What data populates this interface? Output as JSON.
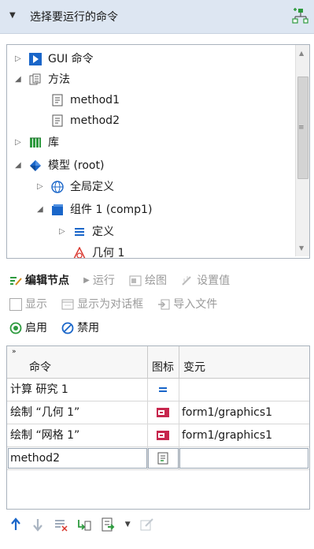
{
  "header": {
    "title": "选择要运行的命令",
    "tool_icon": "tree-add-icon"
  },
  "tree": {
    "items": [
      {
        "label": "GUI 命令",
        "icon": "gui-command-icon",
        "expander": "collapsed"
      },
      {
        "label": "方法",
        "icon": "methods-folder-icon",
        "expander": "expanded"
      },
      {
        "label": "method1",
        "icon": "method-icon",
        "expander": "none"
      },
      {
        "label": "method2",
        "icon": "method-icon",
        "expander": "none"
      },
      {
        "label": "库",
        "icon": "library-icon",
        "expander": "collapsed"
      },
      {
        "label": "模型 (root)",
        "icon": "model-icon",
        "expander": "expanded"
      },
      {
        "label": "全局定义",
        "icon": "globe-icon",
        "expander": "collapsed"
      },
      {
        "label": "组件 1 (comp1)",
        "icon": "component-icon",
        "expander": "expanded"
      },
      {
        "label": "定义",
        "icon": "definitions-icon",
        "expander": "collapsed"
      },
      {
        "label": "几何 1",
        "icon": "geometry-icon",
        "expander": "none"
      }
    ]
  },
  "toolbar": {
    "edit_node": "编辑节点",
    "run": "运行",
    "plot": "绘图",
    "set_value": "设置值",
    "show": "显示",
    "show_as_dialog": "显示为对话框",
    "import_file": "导入文件",
    "enable": "启用",
    "disable": "禁用"
  },
  "grid": {
    "headers": {
      "command": "命令",
      "icon": "图标",
      "argument": "变元"
    },
    "rows": [
      {
        "command": "计算 研究 1",
        "icon": "compute-icon",
        "argument": ""
      },
      {
        "command": "绘制 “几何 1”",
        "icon": "plot-icon",
        "argument": "form1/graphics1"
      },
      {
        "command": "绘制 “网格 1”",
        "icon": "plot-icon",
        "argument": "form1/graphics1"
      },
      {
        "command": "method2",
        "icon": "method-icon",
        "argument": ""
      }
    ]
  },
  "bottom_toolbar": {
    "icons": [
      "move-up-icon",
      "move-down-icon",
      "delete-list-icon",
      "extract-icon",
      "insert-icon",
      "dropdown-arrow-icon",
      "edit-icon"
    ]
  },
  "colors": {
    "accent": "#1a66c9",
    "header_bg": "#dde6f2",
    "green": "#2d9a3e"
  }
}
